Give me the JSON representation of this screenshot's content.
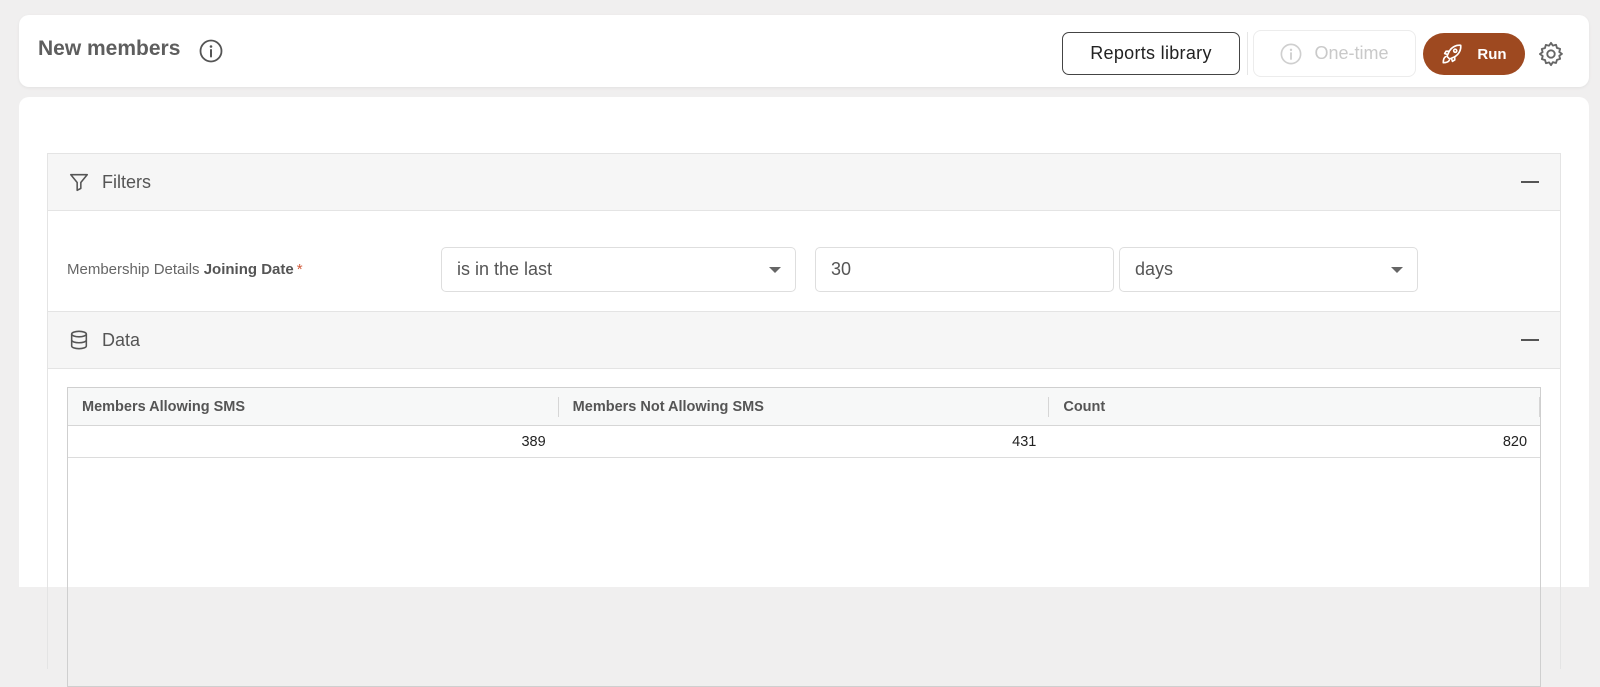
{
  "header": {
    "title": "New members",
    "reports_library_label": "Reports library",
    "one_time_label": "One-time",
    "run_label": "Run"
  },
  "colors": {
    "accent": "#9e4920",
    "required_mark": "#d05a3a"
  },
  "filters": {
    "section_title": "Filters",
    "field_prefix": "Membership Details",
    "field_name": "Joining Date",
    "required_mark": "*",
    "operator": "is in the last",
    "value": "30",
    "unit": "days"
  },
  "data": {
    "section_title": "Data",
    "columns": [
      "Members Allowing SMS",
      "Members Not Allowing SMS",
      "Count"
    ],
    "rows": [
      [
        "389",
        "431",
        "820"
      ]
    ]
  },
  "icons": {
    "title_info": "info-icon",
    "one_time": "info-icon",
    "run": "rocket-icon",
    "settings": "gear-icon",
    "filters": "filter-icon",
    "data": "database-icon",
    "collapse": "minus-icon",
    "dropdown": "caret-down-icon"
  }
}
